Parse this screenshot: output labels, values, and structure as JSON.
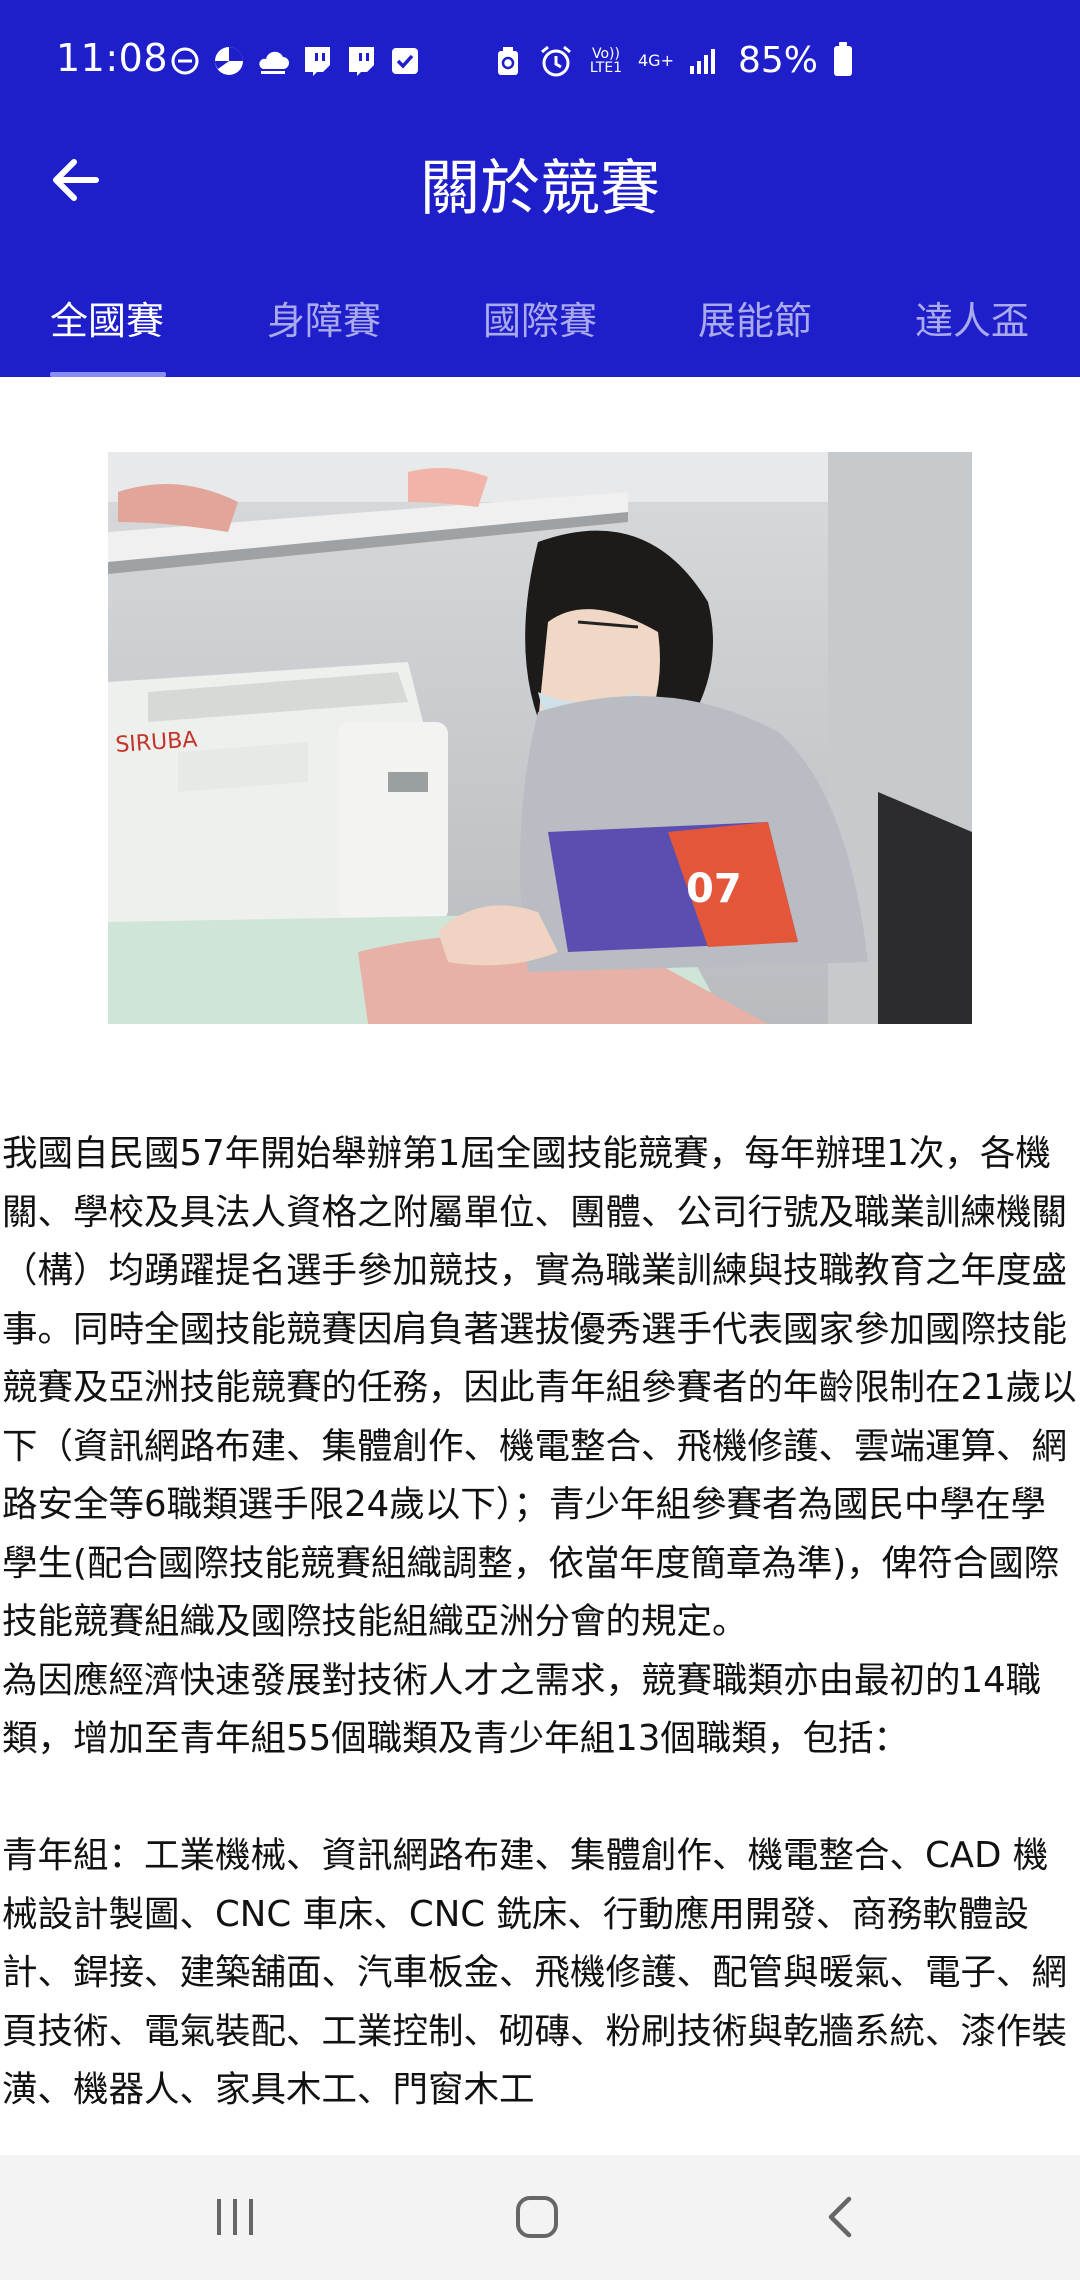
{
  "status": {
    "time": "11:08",
    "left_icons": [
      "minus-circle-icon",
      "pie-icon",
      "cloud-icon",
      "twitch-icon",
      "twitch-icon",
      "check-box-icon"
    ],
    "right_icons": [
      "recycle-icon",
      "alarm-icon",
      "volte-icon",
      "4g-icon",
      "signal-icon"
    ],
    "volte_label": "Vo)) LTE1",
    "net_label": "4G+",
    "battery": "85%"
  },
  "header": {
    "title": "關於競賽",
    "back_icon": "arrow-left-icon"
  },
  "tabs": [
    {
      "label": "全國賽",
      "active": true
    },
    {
      "label": "身障賽",
      "active": false
    },
    {
      "label": "國際賽",
      "active": false
    },
    {
      "label": "展能節",
      "active": false
    },
    {
      "label": "達人盃",
      "active": false
    }
  ],
  "image": {
    "number_tag": "07",
    "brand_on_machine": "SIRUBA"
  },
  "content": {
    "p1": "我國自民國57年開始舉辦第1屆全國技能競賽，每年辦理1次，各機關、學校及具法人資格之附屬單位、團體、公司行號及職業訓練機關（構）均踴躍提名選手參加競技，實為職業訓練與技職教育之年度盛事。同時全國技能競賽因肩負著選拔優秀選手代表國家參加國際技能競賽及亞洲技能競賽的任務，因此青年組參賽者的年齡限制在21歲以下（資訊網路布建、集體創作、機電整合、飛機修護、雲端運算、網路安全等6職類選手限24歲以下）；青少年組參賽者為國民中學在學學生(配合國際技能競賽組織調整，依當年度簡章為準)，俾符合國際技能競賽組織及國際技能組織亞洲分會的規定。",
    "p2": "為因應經濟快速發展對技術人才之需求，競賽職類亦由最初的14職類，增加至青年組55個職類及青少年組13個職類，包括：",
    "p3": "青年組：工業機械、資訊網路布建、集體創作、機電整合、CAD 機械設計製圖、CNC 車床、CNC 銑床、行動應用開發、商務軟體設計、銲接、建築舖面、汽車板金、飛機修護、配管與暖氣、電子、網頁技術、電氣裝配、工業控制、砌磚、粉刷技術與乾牆系統、漆作裝潢、機器人、家具木工、門窗木工"
  },
  "navbar": {
    "icons": [
      "recent-apps-icon",
      "home-icon",
      "back-icon"
    ]
  },
  "colors": {
    "primary": "#1E1ECB",
    "tab_inactive": "#A9AAF0",
    "indicator": "#8A8CF5",
    "nav_bg": "#F3F3F3"
  }
}
